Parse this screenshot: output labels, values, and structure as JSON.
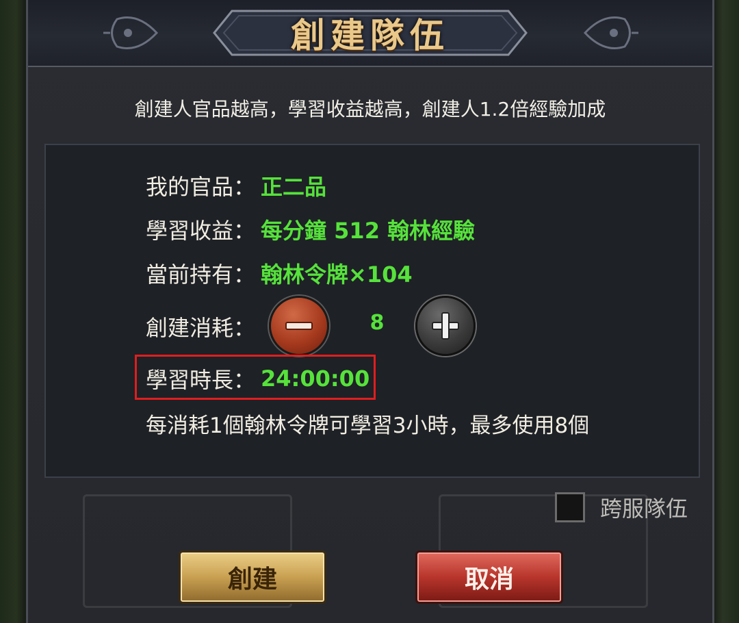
{
  "dialog": {
    "title": "創建隊伍",
    "subtitle": "創建人官品越高，學習收益越高，創建人1.2倍經驗加成"
  },
  "info": {
    "rank_label": "我的官品：",
    "rank_value": "正二品",
    "income_label": "學習收益：",
    "income_value": "每分鐘 512 翰林經驗",
    "holding_label": "當前持有：",
    "holding_value": "翰林令牌×104",
    "cost_label": "創建消耗：",
    "cost_value": "8",
    "duration_label": "學習時長：",
    "duration_value": "24:00:00",
    "note": "每消耗1個翰林令牌可學習3小時，最多使用8個"
  },
  "cross_server": {
    "label": "跨服隊伍",
    "checked": false
  },
  "buttons": {
    "create": "創建",
    "cancel": "取消"
  },
  "colors": {
    "highlight_green": "#56e23b",
    "title_gold": "#e9c88a",
    "annotation_red": "#e01e1e"
  },
  "icons": {
    "minus": "minus-icon",
    "plus": "plus-icon"
  }
}
